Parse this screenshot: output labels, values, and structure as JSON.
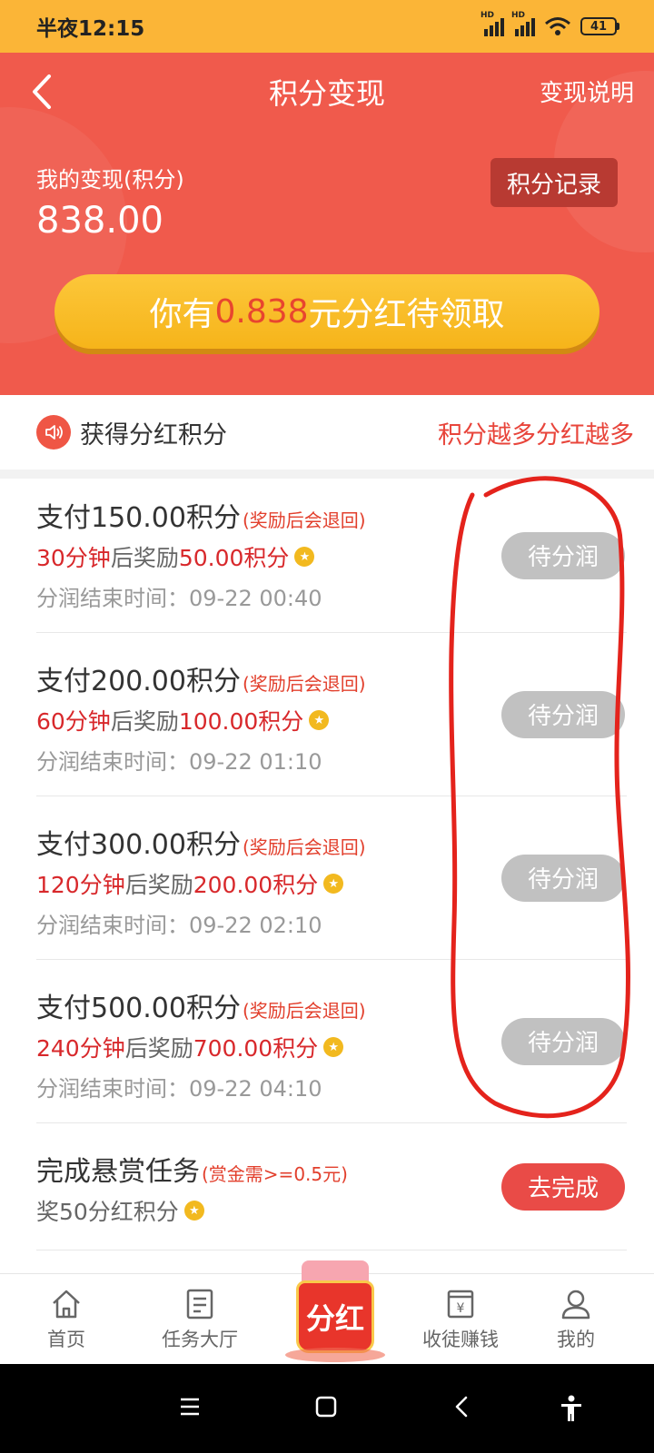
{
  "status_bar": {
    "time": "半夜12:15",
    "battery": "41"
  },
  "header": {
    "title": "积分变现",
    "explain": "变现说明",
    "my_label": "我的变现(积分)",
    "my_value": "838.00",
    "record_button": "积分记录",
    "claim": {
      "prefix": "你有",
      "amount": "0.838",
      "suffix": "元分红待领取"
    }
  },
  "tip_bar": {
    "left": "获得分红积分",
    "right": "积分越多分红越多"
  },
  "tasks": [
    {
      "title": "支付150.00积分",
      "note": "(奖励后会退回)",
      "wait": "30分钟",
      "mid": "后奖励",
      "reward": "50.00积分",
      "end_label": "分润结束时间：",
      "end_time": "09-22 00:40",
      "button": "待分润"
    },
    {
      "title": "支付200.00积分",
      "note": "(奖励后会退回)",
      "wait": "60分钟",
      "mid": "后奖励",
      "reward": "100.00积分",
      "end_label": "分润结束时间：",
      "end_time": "09-22 01:10",
      "button": "待分润"
    },
    {
      "title": "支付300.00积分",
      "note": "(奖励后会退回)",
      "wait": "120分钟",
      "mid": "后奖励",
      "reward": "200.00积分",
      "end_label": "分润结束时间：",
      "end_time": "09-22 02:10",
      "button": "待分润"
    },
    {
      "title": "支付500.00积分",
      "note": "(奖励后会退回)",
      "wait": "240分钟",
      "mid": "后奖励",
      "reward": "700.00积分",
      "end_label": "分润结束时间：",
      "end_time": "09-22 04:10",
      "button": "待分润"
    }
  ],
  "bounty": {
    "title": "完成悬赏任务",
    "note": "(赏金需>=0.5元)",
    "reward": "奖50分红积分",
    "button": "去完成"
  },
  "tabs": [
    {
      "label": "首页",
      "icon": "home-icon"
    },
    {
      "label": "任务大厅",
      "icon": "document-icon"
    },
    {
      "label": "分红",
      "icon": "red-packet-icon"
    },
    {
      "label": "收徒赚钱",
      "icon": "wallet-icon"
    },
    {
      "label": "我的",
      "icon": "user-icon"
    }
  ],
  "colors": {
    "header": "#f05a4c",
    "status_bar": "#fbb537",
    "accent_red": "#d8282b",
    "claim_button": "#f6b41a",
    "pending_button": "#c1c1c1"
  }
}
